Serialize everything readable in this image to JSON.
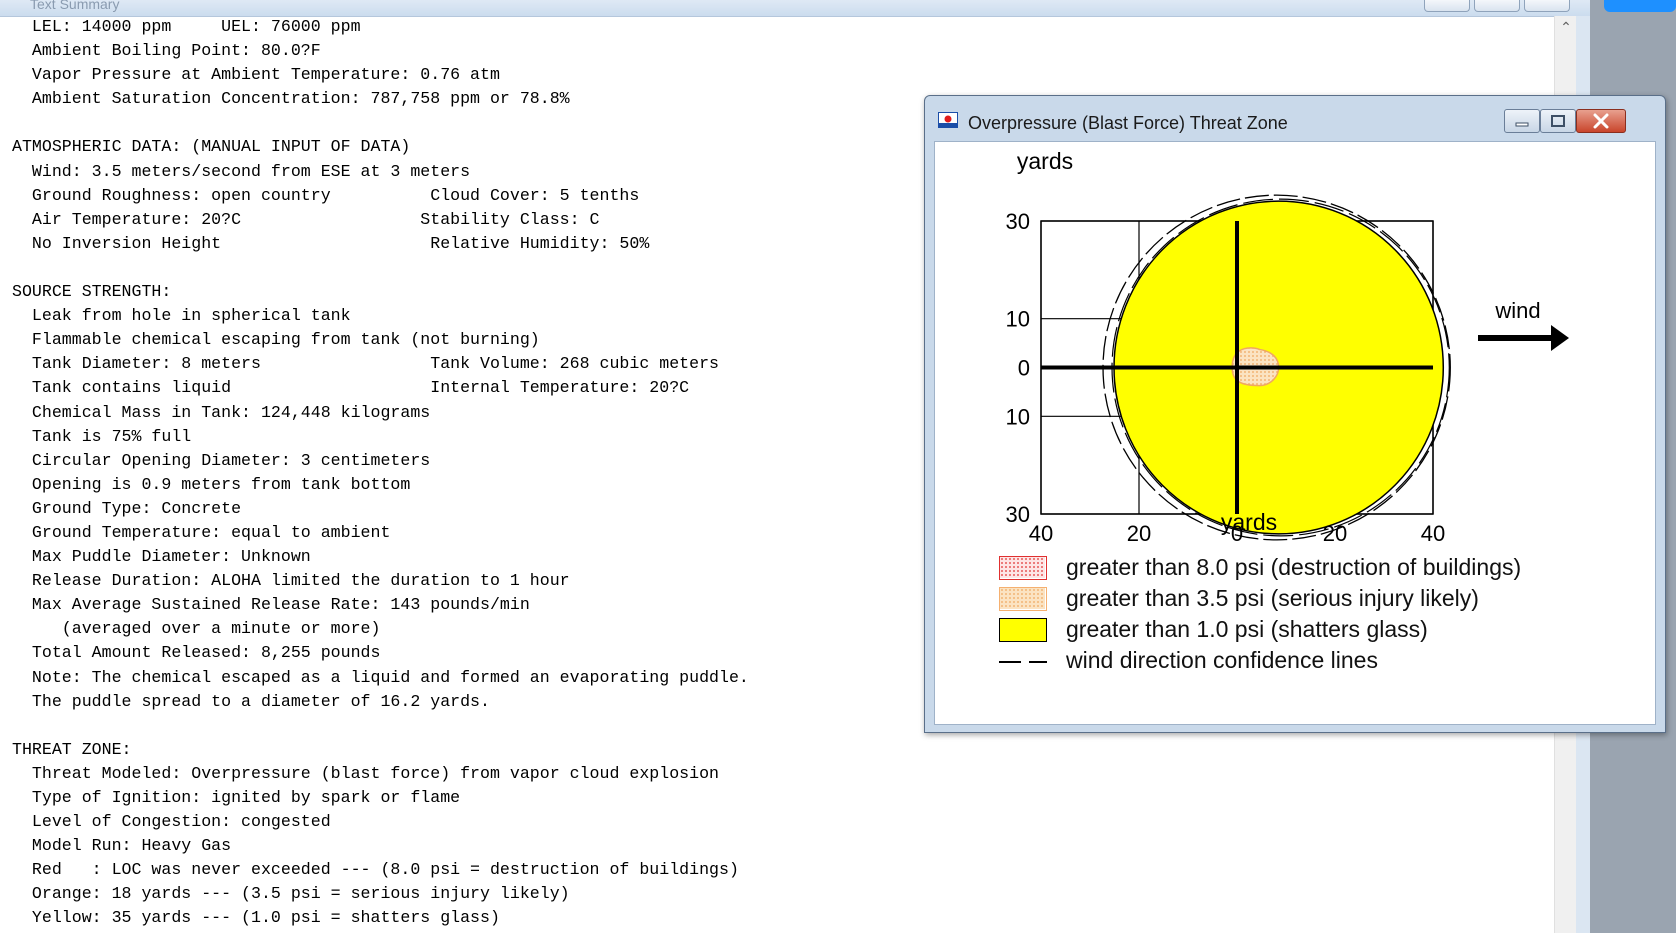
{
  "text_summary": {
    "title": "Text Summary",
    "lines": [
      "  LEL: 14000 ppm     UEL: 76000 ppm",
      "  Ambient Boiling Point: 80.0?F",
      "  Vapor Pressure at Ambient Temperature: 0.76 atm",
      "  Ambient Saturation Concentration: 787,758 ppm or 78.8%",
      "",
      "ATMOSPHERIC DATA: (MANUAL INPUT OF DATA)",
      "  Wind: 3.5 meters/second from ESE at 3 meters",
      "  Ground Roughness: open country          Cloud Cover: 5 tenths",
      "  Air Temperature: 20?C                  Stability Class: C",
      "  No Inversion Height                     Relative Humidity: 50%",
      "",
      "SOURCE STRENGTH:",
      "  Leak from hole in spherical tank",
      "  Flammable chemical escaping from tank (not burning)",
      "  Tank Diameter: 8 meters                 Tank Volume: 268 cubic meters",
      "  Tank contains liquid                    Internal Temperature: 20?C",
      "  Chemical Mass in Tank: 124,448 kilograms",
      "  Tank is 75% full",
      "  Circular Opening Diameter: 3 centimeters",
      "  Opening is 0.9 meters from tank bottom",
      "  Ground Type: Concrete",
      "  Ground Temperature: equal to ambient",
      "  Max Puddle Diameter: Unknown",
      "  Release Duration: ALOHA limited the duration to 1 hour",
      "  Max Average Sustained Release Rate: 143 pounds/min",
      "     (averaged over a minute or more)",
      "  Total Amount Released: 8,255 pounds",
      "  Note: The chemical escaped as a liquid and formed an evaporating puddle.",
      "  The puddle spread to a diameter of 16.2 yards.",
      "",
      "THREAT ZONE:",
      "  Threat Modeled: Overpressure (blast force) from vapor cloud explosion",
      "  Type of Ignition: ignited by spark or flame",
      "  Level of Congestion: congested",
      "  Model Run: Heavy Gas",
      "  Red   : LOC was never exceeded --- (8.0 psi = destruction of buildings)",
      "  Orange: 18 yards --- (3.5 psi = serious injury likely)",
      "  Yellow: 35 yards --- (1.0 psi = shatters glass)"
    ],
    "scroll_up": "⌃"
  },
  "threat_window": {
    "title": "Overpressure (Blast Force) Threat Zone",
    "controls": {
      "minimize": "minimize",
      "maximize": "maximize",
      "close": "close"
    }
  },
  "chart_data": {
    "type": "area",
    "title": "",
    "xlabel": "yards",
    "ylabel": "yards",
    "xlim": [
      -40,
      40
    ],
    "ylim": [
      -30,
      30
    ],
    "x_ticks": [
      {
        "value": -40,
        "label": "40"
      },
      {
        "value": -20,
        "label": "20"
      },
      {
        "value": 0,
        "label": "0"
      },
      {
        "value": 20,
        "label": "20"
      },
      {
        "value": 40,
        "label": "40"
      }
    ],
    "y_ticks": [
      {
        "value": 30,
        "label": "30"
      },
      {
        "value": 10,
        "label": "10"
      },
      {
        "value": 0,
        "label": "0"
      },
      {
        "value": -10,
        "label": "10"
      },
      {
        "value": -30,
        "label": "30"
      }
    ],
    "grid": true,
    "wind_label": "wind",
    "wind_direction": "right",
    "zones": [
      {
        "name": "greater than 1.0 psi (shatters glass)",
        "color": "#ffff00",
        "pattern": "solid",
        "extent_yards": 35
      },
      {
        "name": "greater than 3.5 psi (serious injury likely)",
        "color": "#f5c98f",
        "pattern": "dotted",
        "extent_yards": 18
      }
    ],
    "legend": [
      {
        "label": "greater than 8.0 psi (destruction of buildings)",
        "swatch": "red-dotted",
        "color": "#e03030"
      },
      {
        "label": "greater than 3.5 psi (serious injury likely)",
        "swatch": "orange-dotted",
        "color": "#f5b070"
      },
      {
        "label": "greater than 1.0 psi (shatters glass)",
        "swatch": "yellow",
        "color": "#ffff00"
      },
      {
        "label": "wind direction confidence lines",
        "swatch": "dashed-line",
        "color": "#000000"
      }
    ]
  }
}
